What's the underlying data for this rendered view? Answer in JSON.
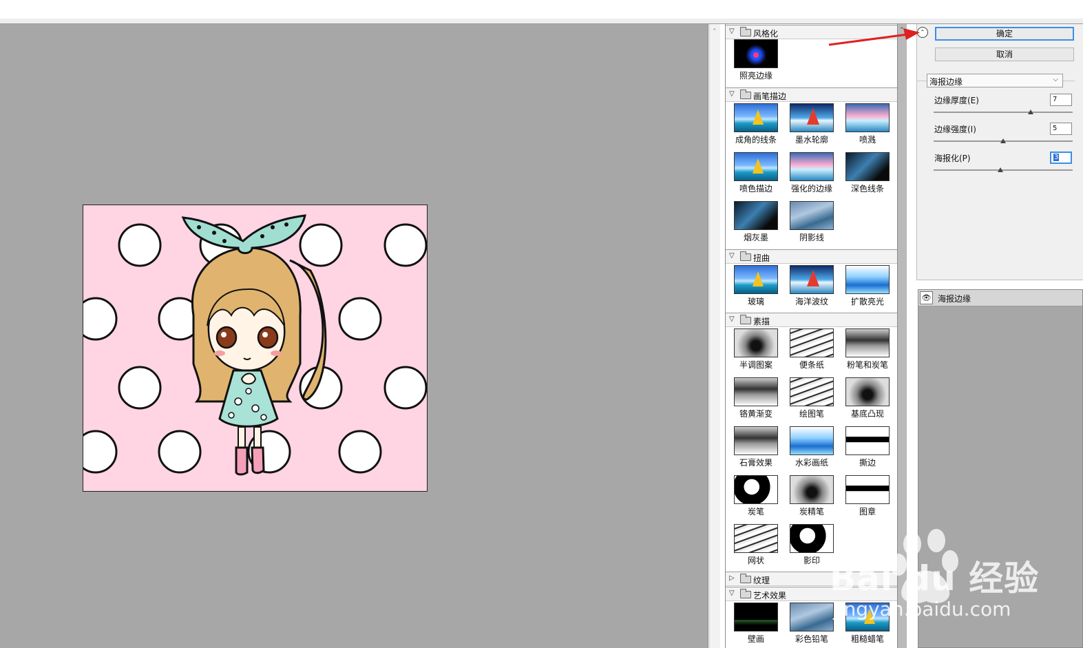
{
  "preview_scroll": {
    "up_glyph": "⌃"
  },
  "gallery": {
    "categories": [
      {
        "label": "风格化",
        "expanded": true,
        "items": [
          {
            "label": "照亮边缘"
          }
        ]
      },
      {
        "label": "画笔描边",
        "expanded": true,
        "items": [
          {
            "label": "成角的线条"
          },
          {
            "label": "墨水轮廓"
          },
          {
            "label": "喷溅"
          },
          {
            "label": "喷色描边"
          },
          {
            "label": "强化的边缘"
          },
          {
            "label": "深色线条"
          },
          {
            "label": "烟灰墨"
          },
          {
            "label": "阴影线"
          }
        ]
      },
      {
        "label": "扭曲",
        "expanded": true,
        "items": [
          {
            "label": "玻璃"
          },
          {
            "label": "海洋波纹"
          },
          {
            "label": "扩散亮光"
          }
        ]
      },
      {
        "label": "素描",
        "expanded": true,
        "items": [
          {
            "label": "半调图案"
          },
          {
            "label": "便条纸"
          },
          {
            "label": "粉笔和炭笔"
          },
          {
            "label": "铬黄渐变"
          },
          {
            "label": "绘图笔"
          },
          {
            "label": "基底凸现"
          },
          {
            "label": "石膏效果"
          },
          {
            "label": "水彩画纸"
          },
          {
            "label": "撕边"
          },
          {
            "label": "炭笔"
          },
          {
            "label": "炭精笔"
          },
          {
            "label": "图章"
          },
          {
            "label": "网状"
          },
          {
            "label": "影印"
          }
        ]
      },
      {
        "label": "纹理",
        "expanded": false,
        "items": []
      },
      {
        "label": "艺术效果",
        "expanded": true,
        "items": [
          {
            "label": "壁画"
          },
          {
            "label": "彩色铅笔"
          },
          {
            "label": "粗糙蜡笔"
          }
        ]
      }
    ]
  },
  "controls": {
    "collapse_glyph": "⌃",
    "ok_label": "确定",
    "cancel_label": "取消",
    "filter_select": "海报边缘",
    "params": [
      {
        "label": "边缘厚度(E)",
        "value": "7",
        "slider_fraction": 0.7
      },
      {
        "label": "边缘强度(I)",
        "value": "5",
        "slider_fraction": 0.5
      },
      {
        "label": "海报化(P)",
        "value": "3",
        "slider_fraction": 0.48
      }
    ]
  },
  "layers": [
    {
      "label": "海报边缘",
      "visible": true
    }
  ],
  "watermark": {
    "text": "Bai du 经验",
    "url": "jingyan.baidu.com"
  },
  "colors": {
    "accent": "#3a8ee6",
    "preview_bg": "#a7a7a7",
    "canvas_bg": "#ffd4e3",
    "annotation_arrow": "#e02020"
  }
}
